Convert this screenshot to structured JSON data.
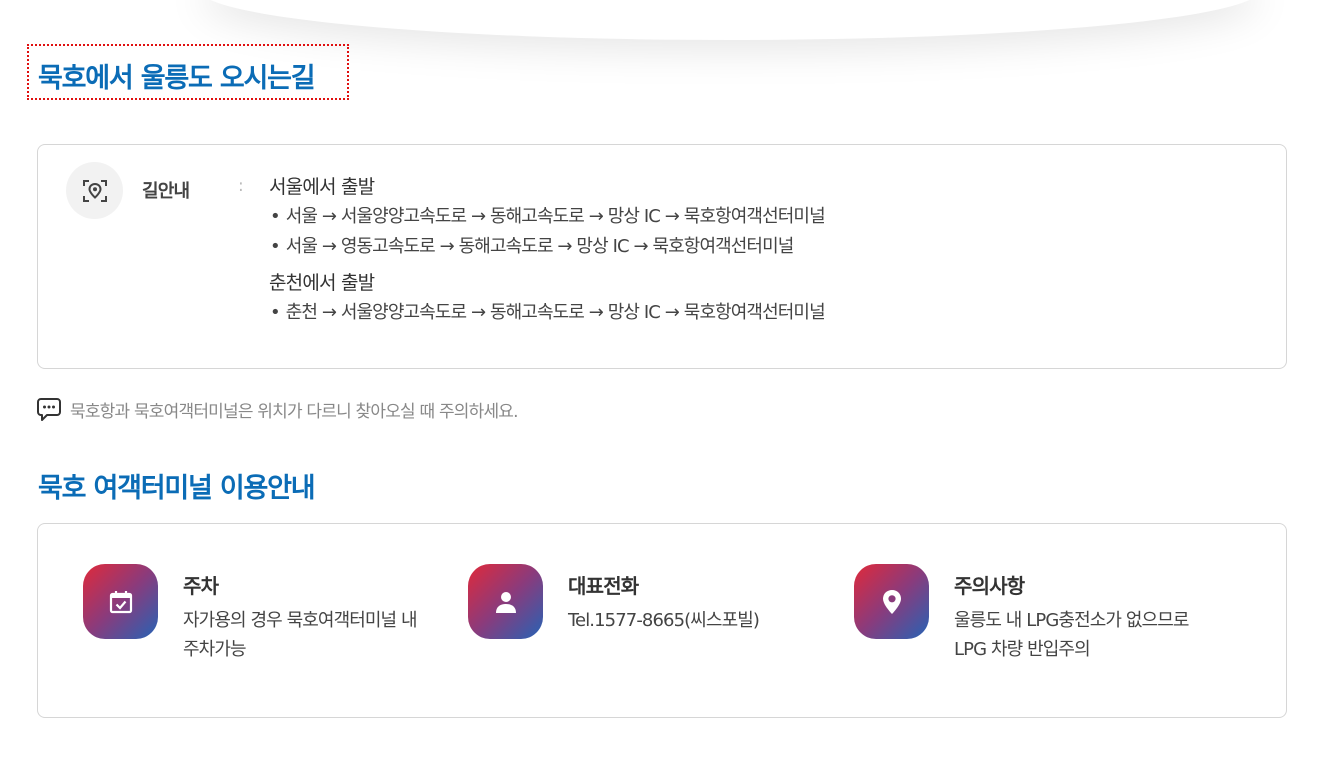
{
  "section1": {
    "title": "묵호에서 울릉도 오시는길"
  },
  "route_card": {
    "label": "길안내",
    "colon": ":",
    "icon": "location-target-icon",
    "groups": [
      {
        "heading": "서울에서 출발",
        "lines": [
          "서울 → 서울양양고속도로 → 동해고속도로 → 망상 IC → 묵호항여객선터미널",
          "서울 → 영동고속도로 → 동해고속도로 → 망상 IC → 묵호항여객선터미널"
        ]
      },
      {
        "heading": "춘천에서 출발",
        "lines": [
          "춘천 → 서울양양고속도로 → 동해고속도로 → 망상 IC → 묵호항여객선터미널"
        ]
      }
    ]
  },
  "notice": {
    "icon": "chat-bubble-icon",
    "text": "묵호항과 묵호여객터미널은 위치가 다르니 찾아오실 때 주의하세요."
  },
  "section2": {
    "title": "묵호 여객터미널 이용안내"
  },
  "info": {
    "parking": {
      "icon": "calendar-check-icon",
      "title": "주차",
      "desc": "자가용의 경우 묵호여객터미널 내 주차가능"
    },
    "phone": {
      "icon": "person-icon",
      "title": "대표전화",
      "desc": "Tel.1577-8665(씨스포빌)"
    },
    "caution": {
      "icon": "map-pin-icon",
      "title": "주의사항",
      "desc": "울릉도 내 LPG충전소가 없으므로 LPG 차량 반입주의"
    }
  },
  "colors": {
    "title_blue": "#0b6cb6",
    "gradient_start": "#e0293a",
    "gradient_end": "#2563b5"
  }
}
